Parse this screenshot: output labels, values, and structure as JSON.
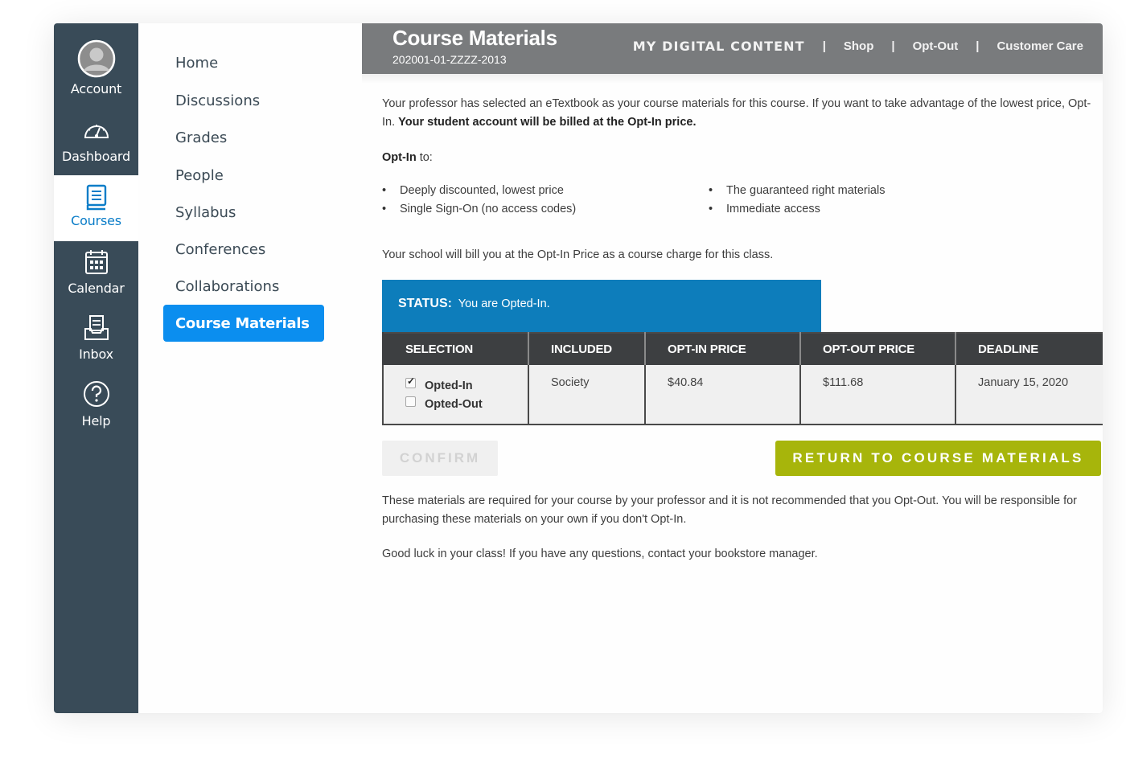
{
  "global_nav": {
    "account": "Account",
    "dashboard": "Dashboard",
    "courses": "Courses",
    "calendar": "Calendar",
    "inbox": "Inbox",
    "help": "Help"
  },
  "course_nav": {
    "items": [
      "Home",
      "Discussions",
      "Grades",
      "People",
      "Syllabus",
      "Conferences",
      "Collaborations"
    ],
    "active": "Course Materials"
  },
  "header": {
    "title": "Course Materials",
    "course_code": "202001-01-ZZZZ-2013",
    "my_digital_content": "MY DIGITAL CONTENT",
    "separator": "|",
    "links": [
      "Shop",
      "Opt-Out",
      "Customer Care"
    ]
  },
  "content": {
    "intro": "Your professor has selected an eTextbook as your course materials for this course. If you want to take advantage of the lowest price, Opt-In.",
    "intro_bold": "Your student account will be billed at the Opt-In price.",
    "optin_label": "Opt-In",
    "optin_to": " to:",
    "bullets": [
      "Deeply discounted, lowest price",
      "Single Sign-On (no access codes)",
      "The guaranteed right materials",
      "Immediate access"
    ],
    "bill_note": "Your school will bill you at the Opt-In Price as a course charge for this class.",
    "status_label": "STATUS:",
    "status_text": "You are Opted-In.",
    "table": {
      "headers": [
        "SELECTION",
        "INCLUDED",
        "OPT-IN PRICE",
        "OPT-OUT PRICE",
        "DEADLINE"
      ],
      "options": [
        {
          "label": "Opted-In",
          "checked": true
        },
        {
          "label": "Opted-Out",
          "checked": false
        }
      ],
      "included": "Society",
      "optin_price": "$40.84",
      "optout_price": "$111.68",
      "deadline": "January 15, 2020"
    },
    "confirm_label": "CONFIRM",
    "return_label": "RETURN TO COURSE MATERIALS",
    "required_note": "These materials are required for your course by your professor and it is not recommended that you Opt-Out. You will be responsible for purchasing these materials on your own if you don't Opt-In.",
    "good_luck": "Good luck in your class! If you have any questions, contact your bookstore manager."
  },
  "colors": {
    "nav_bg": "#394b58",
    "active_blue": "#0b8eef",
    "status_blue": "#0d7dbb",
    "return_green": "#a7b50b",
    "header_gray": "#797b7d"
  }
}
